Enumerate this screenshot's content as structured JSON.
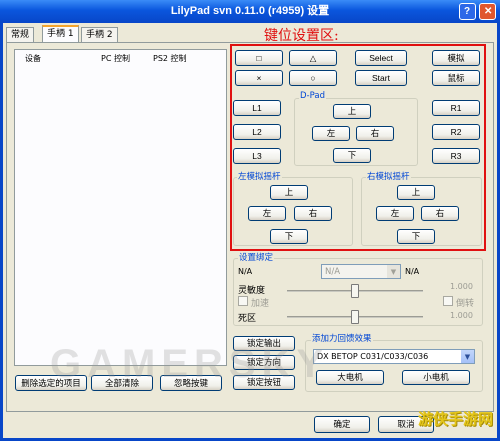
{
  "window": {
    "title": "LilyPad svn 0.11.0 (r4959) 设置",
    "annotation": "键位设置区:"
  },
  "tabs": [
    "常规",
    "手柄 1",
    "手柄 2"
  ],
  "device_list": {
    "headers": [
      "设备",
      "PC 控制",
      "PS2 控制"
    ]
  },
  "bottom_buttons": {
    "delete_selected": "删除选定的项目",
    "clear_all": "全部清除",
    "ignore_key": "忽略按键"
  },
  "keys": {
    "square": "□",
    "triangle": "△",
    "select": "Select",
    "analog": "模拟",
    "cross": "×",
    "circle": "○",
    "start": "Start",
    "mouse": "鼠标",
    "l1": "L1",
    "l2": "L2",
    "l3": "L3",
    "r1": "R1",
    "r2": "R2",
    "r3": "R3"
  },
  "dpad": {
    "label": "D-Pad",
    "up": "上",
    "left": "左",
    "right": "右",
    "down": "下"
  },
  "left_stick": {
    "label": "左模拟摇杆",
    "up": "上",
    "left": "左",
    "right": "右",
    "down": "下"
  },
  "right_stick": {
    "label": "右模拟摇杆",
    "up": "上",
    "left": "左",
    "right": "右",
    "down": "下"
  },
  "binding": {
    "label": "设置绑定",
    "left_value": "N/A",
    "combo_value": "N/A",
    "right_value": "N/A",
    "sensitivity_label": "灵敏度",
    "sensitivity_value": "1.000",
    "sensitivity_level": 0.5,
    "accelerate_label": "加速",
    "flip_label": "倒转",
    "deadzone_label": "死区",
    "deadzone_value": "1.000",
    "deadzone_level": 0.5
  },
  "lock_buttons": {
    "lock_output": "锁定输出",
    "lock_direction": "锁定方向",
    "lock_button": "锁定按钮"
  },
  "feedback": {
    "label": "添加力回馈效果",
    "device": "DX BETOP C031/C033/C036",
    "big_motor": "大电机",
    "small_motor": "小电机"
  },
  "dialog": {
    "ok": "确定",
    "cancel": "取消"
  },
  "watermark": "GAMERSKY",
  "corner_logo": "游侠手游网",
  "colors": {
    "titlebar": "#0846c8",
    "annotation": "#e01010",
    "group_label": "#0046d5"
  }
}
